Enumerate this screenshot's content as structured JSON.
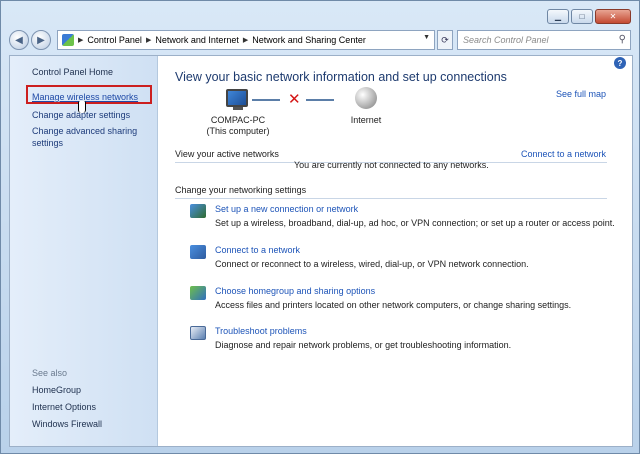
{
  "address": {
    "crumbs": [
      "Control Panel",
      "Network and Internet",
      "Network and Sharing Center"
    ],
    "search_placeholder": "Search Control Panel"
  },
  "sidebar": {
    "home": "Control Panel Home",
    "links": [
      "Manage wireless networks",
      "Change adapter settings",
      "Change advanced sharing settings"
    ],
    "see_also_label": "See also",
    "see_also": [
      "HomeGroup",
      "Internet Options",
      "Windows Firewall"
    ]
  },
  "main": {
    "title": "View your basic network information and set up connections",
    "see_full_map": "See full map",
    "computer_name": "COMPAC-PC",
    "computer_sub": "(This computer)",
    "internet_label": "Internet",
    "active_networks_head": "View your active networks",
    "connect_link": "Connect to a network",
    "active_status": "You are currently not connected to any networks.",
    "settings_head": "Change your networking settings",
    "tasks": [
      {
        "title": "Set up a new connection or network",
        "desc": "Set up a wireless, broadband, dial-up, ad hoc, or VPN connection; or set up a router or access point.",
        "icon": "new-connection-icon"
      },
      {
        "title": "Connect to a network",
        "desc": "Connect or reconnect to a wireless, wired, dial-up, or VPN network connection.",
        "icon": "connect-network-icon"
      },
      {
        "title": "Choose homegroup and sharing options",
        "desc": "Access files and printers located on other network computers, or change sharing settings.",
        "icon": "homegroup-icon"
      },
      {
        "title": "Troubleshoot problems",
        "desc": "Diagnose and repair network problems, or get troubleshooting information.",
        "icon": "troubleshoot-icon"
      }
    ]
  },
  "colors": {
    "link": "#1d54b8",
    "highlight_box": "#cc1f1f",
    "x_mark": "#d41616"
  }
}
